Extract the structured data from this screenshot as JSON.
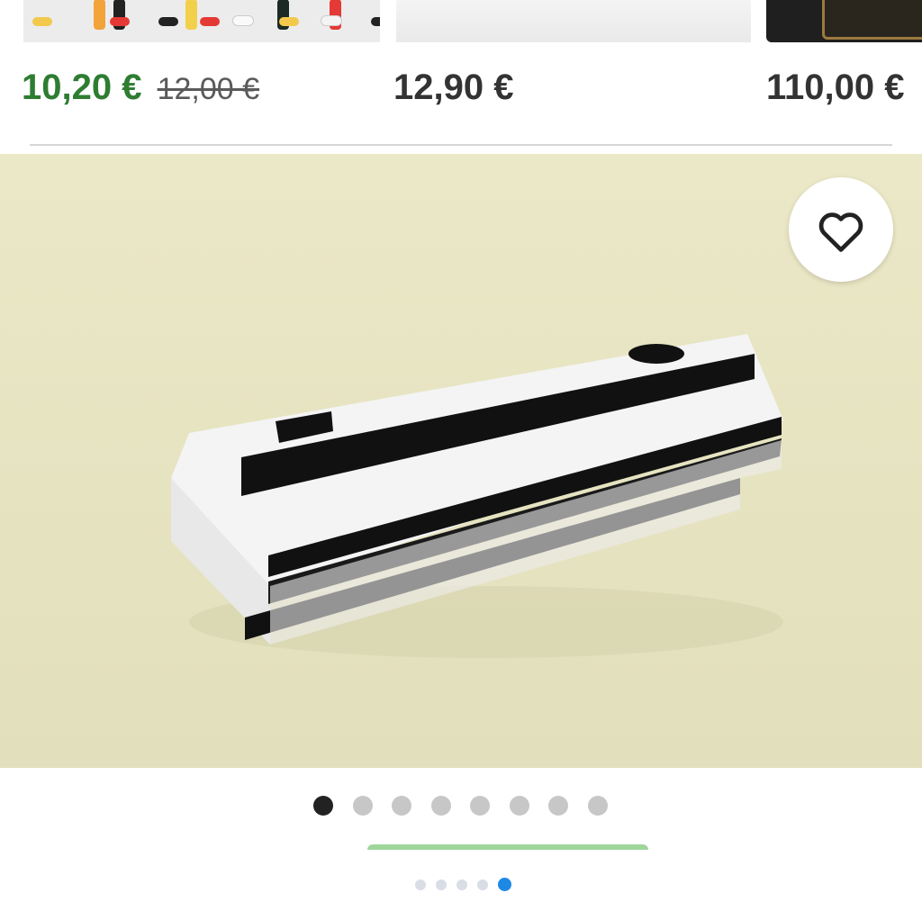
{
  "related_products": [
    {
      "price": "10,20 €",
      "old_price": "12,00 €"
    },
    {
      "price": "12,90 €"
    },
    {
      "price": "110,00 €"
    }
  ],
  "gallery": {
    "image_count": 8,
    "active_index": 0,
    "favorite_icon": "heart-outline-icon"
  },
  "page_indicator": {
    "count": 5,
    "active_index": 4
  },
  "colors": {
    "sale_price": "#2e7d32",
    "regular_price": "#333333",
    "hero_background": "#e6e3c0",
    "active_dot": "#222222",
    "inactive_dot": "#c7c7c7",
    "pager_active": "#1e88e5",
    "cta_green": "#9ed69a"
  }
}
